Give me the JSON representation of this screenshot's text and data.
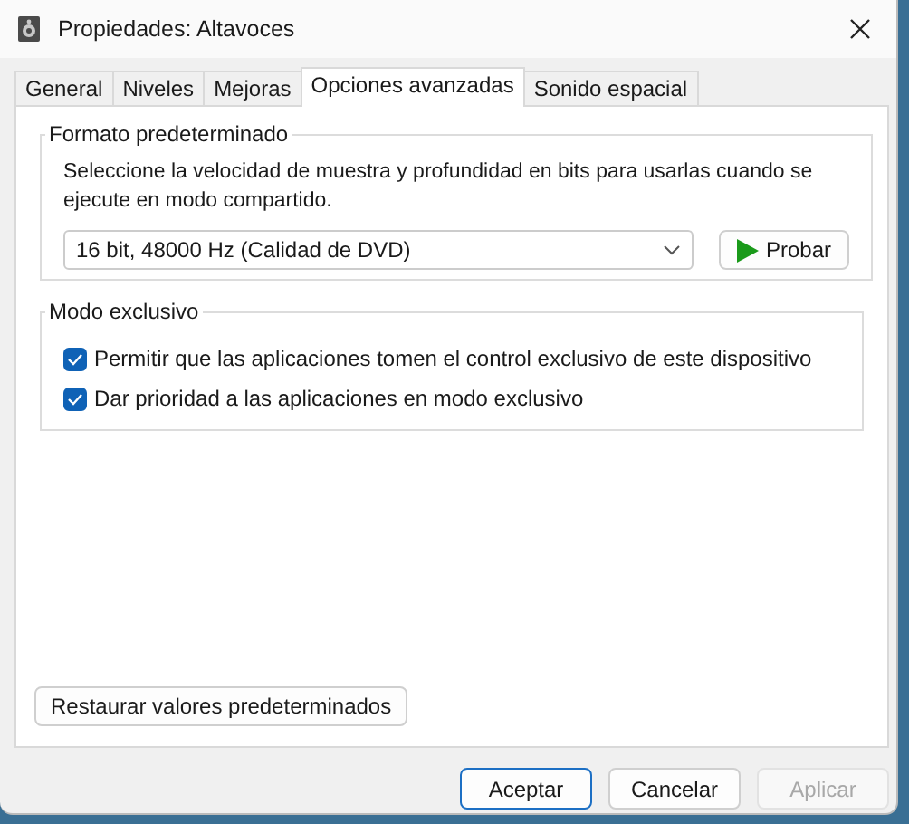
{
  "window": {
    "title": "Propiedades: Altavoces"
  },
  "tabs": [
    {
      "label": "General",
      "selected": false
    },
    {
      "label": "Niveles",
      "selected": false
    },
    {
      "label": "Mejoras",
      "selected": false
    },
    {
      "label": "Opciones avanzadas",
      "selected": true
    },
    {
      "label": "Sonido espacial",
      "selected": false
    }
  ],
  "default_format": {
    "legend": "Formato predeterminado",
    "description": "Seleccione la velocidad de muestra y profundidad en bits para usarlas cuando se ejecute en modo compartido.",
    "dropdown": {
      "value": "16 bit, 48000 Hz (Calidad de DVD)"
    },
    "test_button": "Probar"
  },
  "exclusive_mode": {
    "legend": "Modo exclusivo",
    "options": [
      {
        "label": "Permitir que las aplicaciones tomen el control exclusivo de este dispositivo",
        "checked": true
      },
      {
        "label": "Dar prioridad a las aplicaciones en modo exclusivo",
        "checked": true
      }
    ]
  },
  "restore_button": "Restaurar valores predeterminados",
  "buttons": [
    {
      "label": "Aceptar",
      "default": true,
      "disabled": false
    },
    {
      "label": "Cancelar",
      "default": false,
      "disabled": false
    },
    {
      "label": "Aplicar",
      "default": false,
      "disabled": true
    }
  ]
}
